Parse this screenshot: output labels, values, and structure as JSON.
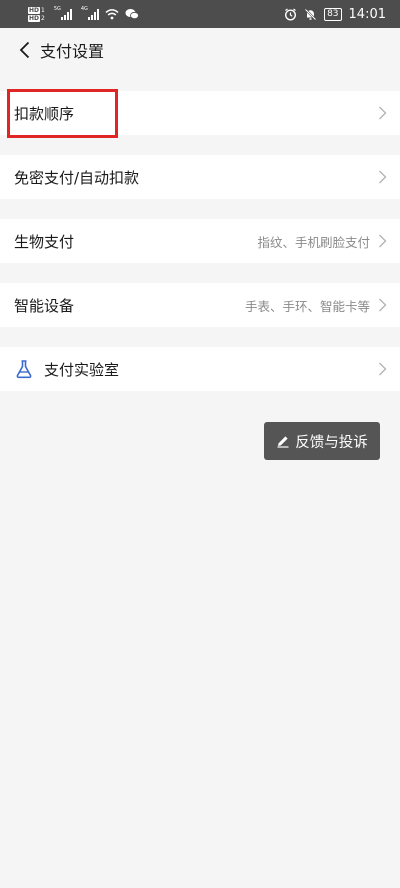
{
  "status_bar": {
    "sim1": "1",
    "sim2": "2",
    "network1": "5G",
    "network2": "4G",
    "hd": "HD",
    "battery": "83",
    "time": "14:01"
  },
  "header": {
    "title": "支付设置"
  },
  "settings": [
    {
      "label": "扣款顺序",
      "value": ""
    },
    {
      "label": "免密支付/自动扣款",
      "value": ""
    },
    {
      "label": "生物支付",
      "value": "指纹、手机刷脸支付"
    },
    {
      "label": "智能设备",
      "value": "手表、手环、智能卡等"
    },
    {
      "label": "支付实验室",
      "value": ""
    }
  ],
  "feedback": {
    "label": "反馈与投诉"
  },
  "colors": {
    "background": "#f5f5f5",
    "status_bar": "#4d4d4d",
    "highlight": "#e02525",
    "lab_icon": "#3b6bd1",
    "feedback_bg": "#555555"
  }
}
